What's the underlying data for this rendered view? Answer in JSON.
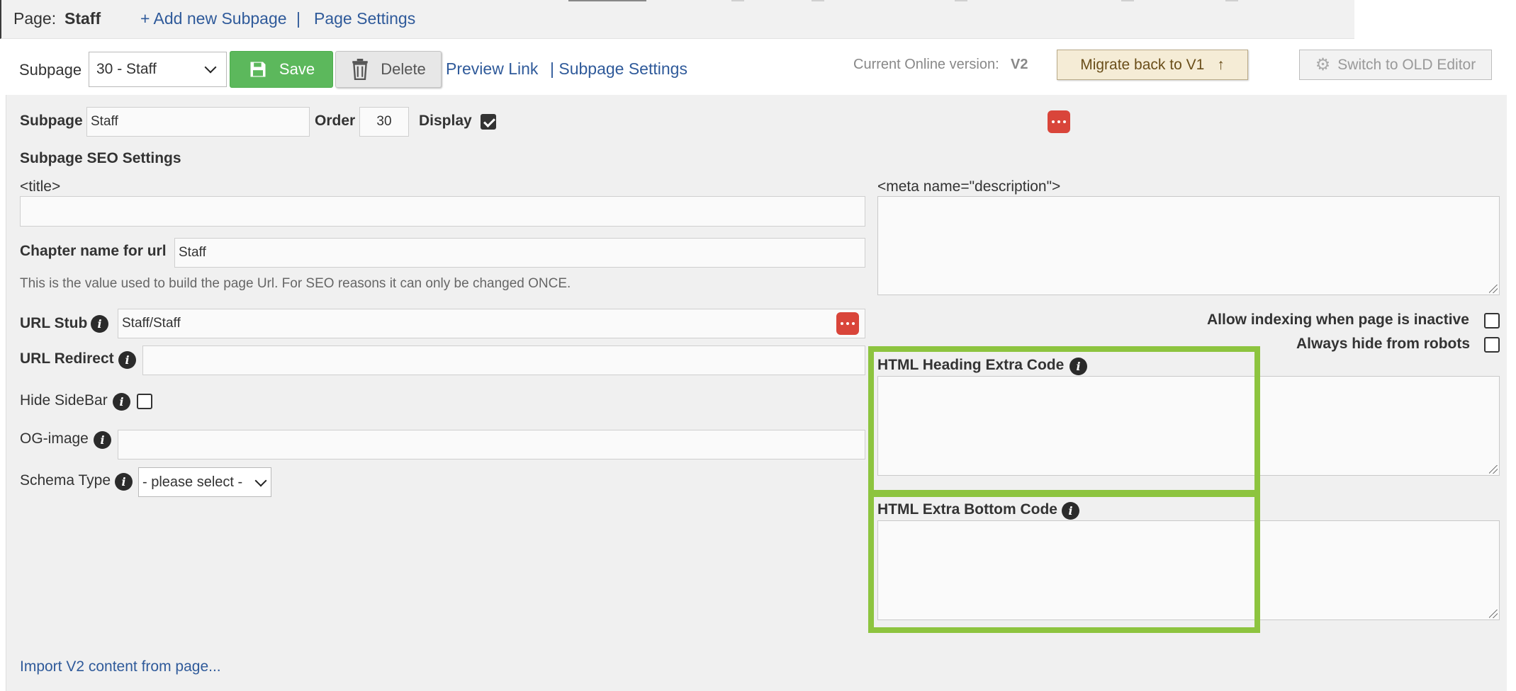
{
  "header": {
    "page_prefix": "Page:",
    "page_name": "Staff",
    "add_subpage": "+ Add new Subpage",
    "separator": "|",
    "page_settings": "Page Settings"
  },
  "toolbar": {
    "subpage_label": "Subpage",
    "subpage_selected": "30 - Staff",
    "save_label": "Save",
    "delete_label": "Delete",
    "preview_link": "Preview Link",
    "subpage_settings": "| Subpage Settings",
    "online_version_label": "Current Online version:",
    "online_version_value": "V2",
    "migrate_label": "Migrate back to V1",
    "switch_editor_label": "Switch to OLD Editor"
  },
  "form": {
    "subpage_label": "Subpage",
    "subpage_value": "Staff",
    "order_label": "Order",
    "order_value": "30",
    "display_label": "Display",
    "display_checked": true,
    "seo_heading": "Subpage SEO Settings",
    "title_label": "<title>",
    "title_value": "",
    "meta_desc_label": "<meta name=\"description\">",
    "meta_desc_value": "",
    "chapter_label": "Chapter name for url",
    "chapter_value": "Staff",
    "chapter_help": "This is the value used to build the page Url. For SEO reasons it can only be changed ONCE.",
    "url_stub_label": "URL Stub",
    "url_stub_value": "Staff/Staff",
    "url_redirect_label": "URL Redirect",
    "url_redirect_value": "",
    "hide_sidebar_label": "Hide SideBar",
    "og_image_label": "OG-image",
    "og_image_value": "",
    "schema_label": "Schema Type",
    "schema_selected": "- please select -",
    "allow_indexing_label": "Allow indexing when page is inactive",
    "hide_robots_label": "Always hide from robots",
    "html_heading_label": "HTML Heading Extra Code",
    "html_bottom_label": "HTML Extra Bottom Code",
    "import_link": "Import V2 content from page..."
  },
  "icons": {
    "info_glyph": "i",
    "arrow_up": "↑",
    "gears": "⚙"
  },
  "colors": {
    "link": "#2f5a9a",
    "save_green": "#5cb85c",
    "highlight_green": "#8dc43f",
    "dots_red": "#d9453a",
    "migrate_bg": "#f5ecd6"
  }
}
